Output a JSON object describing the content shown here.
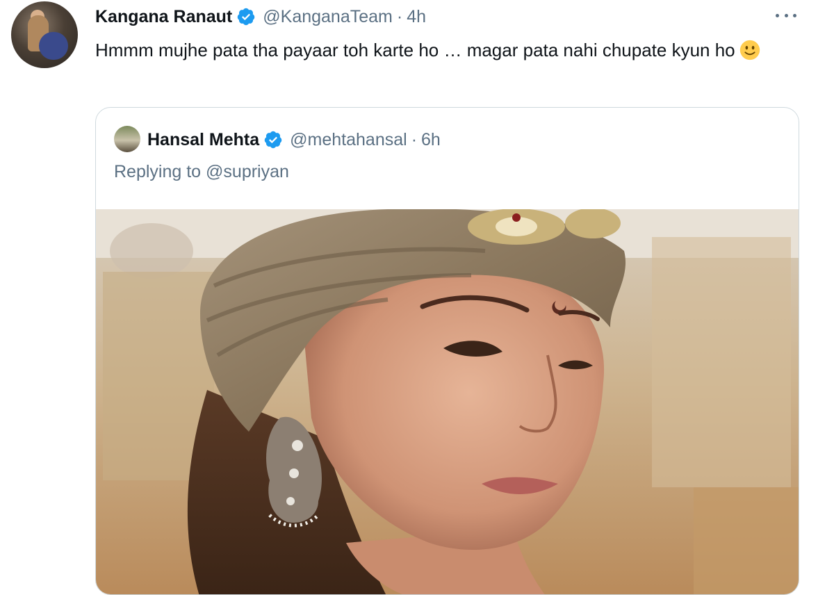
{
  "tweet": {
    "author_name": "Kangana Ranaut",
    "author_handle": "@KanganaTeam",
    "separator": "·",
    "time": "4h",
    "text": "Hmmm mujhe pata tha payaar toh karte ho … magar pata nahi chupate kyun ho",
    "emoji": "slightly-smiling-face-icon"
  },
  "quoted_tweet": {
    "author_name": "Hansal Mehta",
    "author_handle": "@mehtahansal",
    "separator": "·",
    "time": "6h",
    "replying_prefix": "Replying to",
    "replying_to": "@supriyan"
  },
  "icons": {
    "verified": "verified-badge-icon",
    "more": "more-options-icon"
  },
  "colors": {
    "verified_blue": "#1d9bf0",
    "secondary_text": "#5b7083",
    "primary_text": "#0f1419",
    "border": "#cfd9de"
  }
}
